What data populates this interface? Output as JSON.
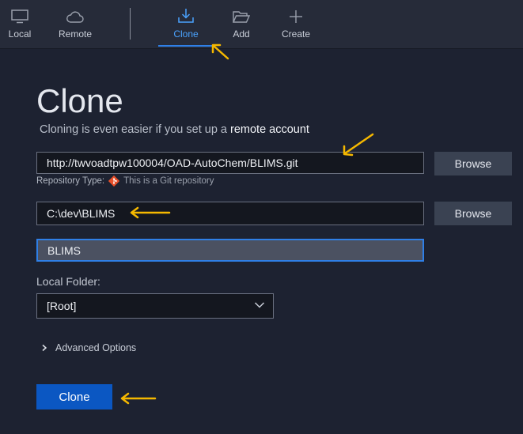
{
  "toolbar": {
    "local_label": "Local",
    "remote_label": "Remote",
    "clone_label": "Clone",
    "add_label": "Add",
    "create_label": "Create"
  },
  "page": {
    "title": "Clone",
    "subtitle_prefix": "Cloning is even easier if you set up a ",
    "subtitle_link": "remote account"
  },
  "form": {
    "repo_url": "http://twvoadtpw100004/OAD-AutoChem/BLIMS.git",
    "browse_label": "Browse",
    "repo_type_label": "Repository Type:",
    "repo_type_value": "This is a Git repository",
    "destination_path": "C:\\dev\\BLIMS",
    "name": "BLIMS",
    "local_folder_label": "Local Folder:",
    "local_folder_value": "[Root]",
    "advanced_label": "Advanced Options",
    "clone_button_label": "Clone"
  },
  "colors": {
    "accent": "#2f7fe6",
    "primary_button": "#0b57c2",
    "annotation_arrow": "#f5b800",
    "git_icon": "#e8502a"
  },
  "icons": {
    "local": "monitor-icon",
    "remote": "cloud-icon",
    "clone": "download-icon",
    "add": "folder-open-icon",
    "create": "plus-icon",
    "git": "git-icon",
    "select": "chevron-down-icon",
    "advanced": "chevron-right-icon",
    "annotation": "arrow-icon"
  }
}
